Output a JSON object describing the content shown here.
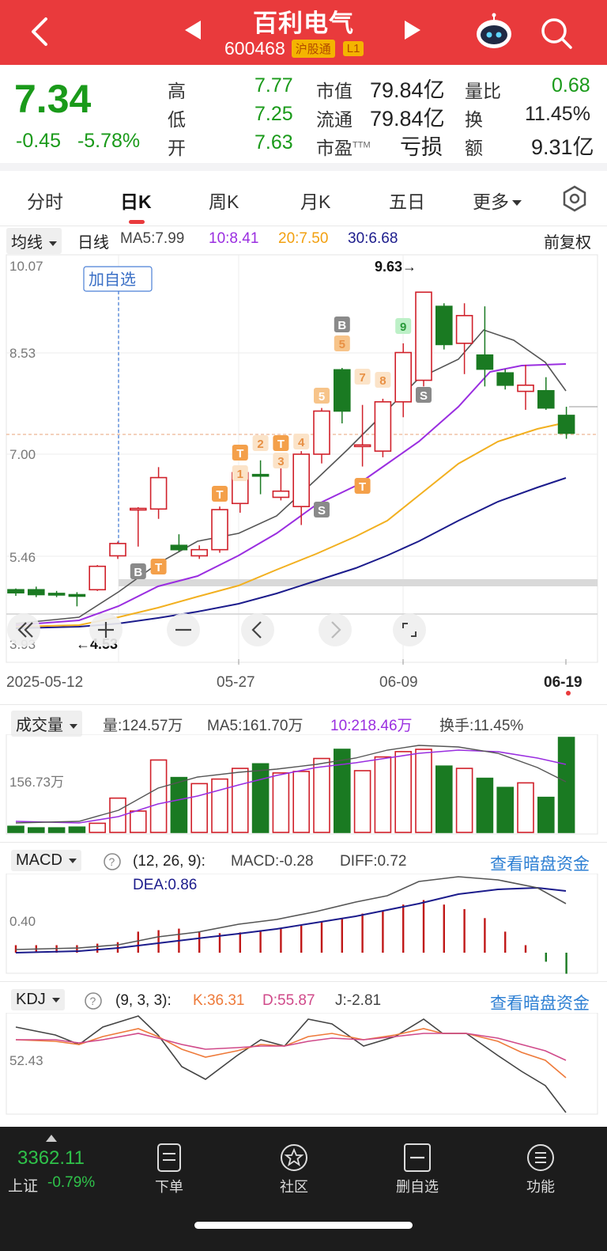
{
  "header": {
    "title": "百利电气",
    "code": "600468",
    "tag_connect": "沪股通",
    "tag_level": "L1"
  },
  "quote": {
    "price": "7.34",
    "change": "-0.45",
    "change_pct": "-5.78%",
    "rows": [
      {
        "l1": "高",
        "v1": "7.77",
        "l2": "市值",
        "v2": "79.84亿",
        "l3": "量比",
        "v3": "0.68"
      },
      {
        "l1": "低",
        "v1": "7.25",
        "l2": "流通",
        "v2": "79.84亿",
        "l3": "换",
        "v3": "11.45%"
      },
      {
        "l1": "开",
        "v1": "7.63",
        "l2": "市盈",
        "l2_sup": "TTM",
        "v2": "亏损",
        "l3": "额",
        "v3": "9.31亿"
      }
    ]
  },
  "tabs": [
    {
      "label": "分时"
    },
    {
      "label": "日K"
    },
    {
      "label": "周K"
    },
    {
      "label": "月K"
    },
    {
      "label": "五日"
    },
    {
      "label": "更多"
    }
  ],
  "ma_legend": {
    "dropdown": "均线",
    "type": "日线",
    "ma5": "MA5:7.99",
    "ma10": "10:8.41",
    "ma20": "20:7.50",
    "ma30": "30:6.68",
    "fuquan": "前复权"
  },
  "kline": {
    "y_labels": [
      "10.07",
      "8.53",
      "7.00",
      "5.46",
      "3.93"
    ],
    "date_labels": [
      "2025-05-12",
      "05-27",
      "06-09",
      "06-19"
    ],
    "max_marker": "9.63→",
    "min_marker": "←4.53",
    "add_watch": "加自选",
    "badges": [
      "B",
      "T",
      "T",
      "1",
      "T",
      "2",
      "T",
      "3",
      "4",
      "S",
      "5",
      "B",
      "5",
      "T",
      "7",
      "8",
      "9",
      "S"
    ]
  },
  "volume": {
    "dropdown": "成交量",
    "vol": "量:124.57万",
    "ma5": "MA5:161.70万",
    "ma10": "10:218.46万",
    "turnover": "换手:11.45%",
    "axis_label": "156.73万"
  },
  "macd": {
    "dropdown": "MACD",
    "params": "(12, 26, 9):",
    "macd": "MACD:-0.28",
    "diff": "DIFF:0.72",
    "dea": "DEA:0.86",
    "axis_label": "0.40",
    "link": "查看暗盘资金"
  },
  "kdj": {
    "dropdown": "KDJ",
    "params": "(9, 3, 3):",
    "k": "K:36.31",
    "d": "D:55.87",
    "j": "J:-2.81",
    "axis_label": "52.43",
    "link": "查看暗盘资金"
  },
  "bottom": {
    "index_value": "3362.11",
    "index_name": "上证",
    "index_change": "-0.79%",
    "items": [
      {
        "label": "下单"
      },
      {
        "label": "社区"
      },
      {
        "label": "删自选"
      },
      {
        "label": "功能"
      }
    ]
  },
  "colors": {
    "up": "#d0202a",
    "down": "#1a7a22",
    "header_bg": "#e93a3c",
    "ma5": "#555555",
    "ma10": "#9a2ee0",
    "ma20": "#f2b020",
    "ma30": "#1c1c8c"
  },
  "chart_data": {
    "type": "candlestick",
    "dates_shown": [
      "2025-05-12",
      "05-27",
      "06-09",
      "06-19"
    ],
    "ylim": [
      3.93,
      10.07
    ],
    "candles": [
      {
        "o": 4.8,
        "c": 4.75,
        "h": 4.82,
        "l": 4.7
      },
      {
        "o": 4.8,
        "c": 4.72,
        "h": 4.85,
        "l": 4.68
      },
      {
        "o": 4.74,
        "c": 4.72,
        "h": 4.78,
        "l": 4.68
      },
      {
        "o": 4.72,
        "c": 4.7,
        "h": 4.76,
        "l": 4.53
      },
      {
        "o": 4.8,
        "c": 5.18,
        "h": 5.2,
        "l": 4.78
      },
      {
        "o": 5.35,
        "c": 5.55,
        "h": 5.58,
        "l": 5.3
      },
      {
        "o": 6.1,
        "c": 6.12,
        "h": 6.14,
        "l": 5.5
      },
      {
        "o": 6.11,
        "c": 6.62,
        "h": 6.79,
        "l": 5.95
      },
      {
        "o": 5.52,
        "c": 5.45,
        "h": 5.7,
        "l": 5.42
      },
      {
        "o": 5.35,
        "c": 5.45,
        "h": 5.52,
        "l": 5.3
      },
      {
        "o": 5.45,
        "c": 6.1,
        "h": 6.15,
        "l": 5.4
      },
      {
        "o": 6.2,
        "c": 6.7,
        "h": 6.72,
        "l": 6.05
      },
      {
        "o": 6.67,
        "c": 6.66,
        "h": 6.9,
        "l": 6.35
      },
      {
        "o": 6.3,
        "c": 6.4,
        "h": 6.8,
        "l": 6.25
      },
      {
        "o": 6.15,
        "c": 7.0,
        "h": 7.05,
        "l": 5.85
      },
      {
        "o": 7.0,
        "c": 7.7,
        "h": 7.75,
        "l": 6.85
      },
      {
        "o": 8.37,
        "c": 7.7,
        "h": 8.4,
        "l": 7.5
      },
      {
        "o": 7.15,
        "c": 7.15,
        "h": 7.8,
        "l": 6.8
      },
      {
        "o": 7.05,
        "c": 7.85,
        "h": 7.9,
        "l": 6.95
      },
      {
        "o": 7.85,
        "c": 8.65,
        "h": 8.8,
        "l": 7.6
      },
      {
        "o": 8.2,
        "c": 9.63,
        "h": 9.63,
        "l": 8.1
      },
      {
        "o": 9.4,
        "c": 8.78,
        "h": 9.45,
        "l": 8.7
      },
      {
        "o": 8.8,
        "c": 9.25,
        "h": 9.45,
        "l": 8.3
      },
      {
        "o": 8.61,
        "c": 8.38,
        "h": 9.4,
        "l": 8.1
      },
      {
        "o": 8.32,
        "c": 8.12,
        "h": 8.38,
        "l": 8.05
      },
      {
        "o": 8.02,
        "c": 8.12,
        "h": 8.45,
        "l": 7.72
      },
      {
        "o": 8.03,
        "c": 7.75,
        "h": 8.25,
        "l": 7.72
      },
      {
        "o": 7.63,
        "c": 7.34,
        "h": 7.77,
        "l": 7.25
      }
    ],
    "volume_series": [
      8,
      6,
      6,
      7,
      12,
      45,
      28,
      95,
      72,
      64,
      70,
      84,
      90,
      78,
      80,
      97,
      109,
      81,
      99,
      106,
      109,
      87,
      84,
      71,
      59,
      65,
      46,
      124.57
    ],
    "volume_axis_label": 156.73,
    "macd_hist": [
      0.1,
      0.1,
      0.1,
      0.1,
      0.12,
      0.14,
      0.28,
      0.3,
      0.32,
      0.28,
      0.26,
      0.27,
      0.3,
      0.32,
      0.36,
      0.42,
      0.46,
      0.52,
      0.56,
      0.64,
      0.7,
      0.64,
      0.58,
      0.46,
      0.28,
      0.1,
      -0.12,
      -0.28
    ],
    "kdj_params": "9,3,3"
  }
}
